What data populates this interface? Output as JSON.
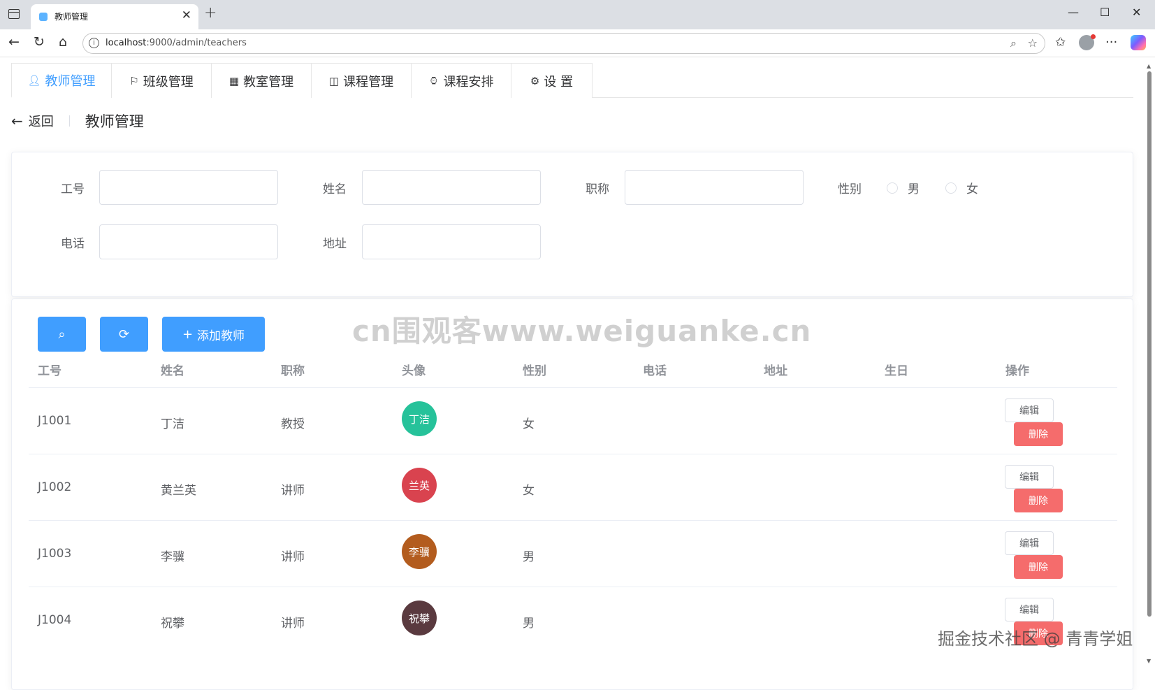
{
  "browser": {
    "tab_title": "教师管理",
    "tab_close": "✕",
    "new_tab": "+",
    "url_host": "localhost",
    "url_path": ":9000/admin/teachers"
  },
  "menu": {
    "items": [
      {
        "label": "教师管理",
        "icon": "user-icon"
      },
      {
        "label": "班级管理",
        "icon": "flag-icon"
      },
      {
        "label": "教室管理",
        "icon": "building-icon"
      },
      {
        "label": "课程管理",
        "icon": "book-icon"
      },
      {
        "label": "课程安排",
        "icon": "watch-icon"
      },
      {
        "label": "设 置",
        "icon": "gear-icon"
      }
    ]
  },
  "header": {
    "back": "返回",
    "title": "教师管理"
  },
  "search_form": {
    "employee_no": "工号",
    "name": "姓名",
    "title": "职称",
    "gender": "性别",
    "gender_male": "男",
    "gender_female": "女",
    "phone": "电话",
    "address": "地址"
  },
  "actions": {
    "add_teacher": "添加教师"
  },
  "table": {
    "columns": [
      "工号",
      "姓名",
      "职称",
      "头像",
      "性别",
      "电话",
      "地址",
      "生日",
      "操作"
    ],
    "rows": [
      {
        "id": "J1001",
        "name": "丁洁",
        "title": "教授",
        "avatar_text": "丁洁",
        "avatar_color": "#26c29a",
        "gender": "女",
        "phone": "",
        "address": "",
        "birthday": ""
      },
      {
        "id": "J1002",
        "name": "黄兰英",
        "title": "讲师",
        "avatar_text": "兰英",
        "avatar_color": "#d9434f",
        "gender": "女",
        "phone": "",
        "address": "",
        "birthday": ""
      },
      {
        "id": "J1003",
        "name": "李骥",
        "title": "讲师",
        "avatar_text": "李骥",
        "avatar_color": "#b35c1e",
        "gender": "男",
        "phone": "",
        "address": "",
        "birthday": ""
      },
      {
        "id": "J1004",
        "name": "祝攀",
        "title": "讲师",
        "avatar_text": "祝攀",
        "avatar_color": "#5a3a3f",
        "gender": "男",
        "phone": "",
        "address": "",
        "birthday": ""
      }
    ],
    "edit_label": "编辑",
    "delete_label": "删除"
  },
  "watermarks": {
    "site": "cn围观客www.weiguanke.cn",
    "juejin": "掘金技术社区 @ 青青学姐"
  },
  "colors": {
    "primary": "#409eff",
    "danger": "#f56c6c"
  }
}
